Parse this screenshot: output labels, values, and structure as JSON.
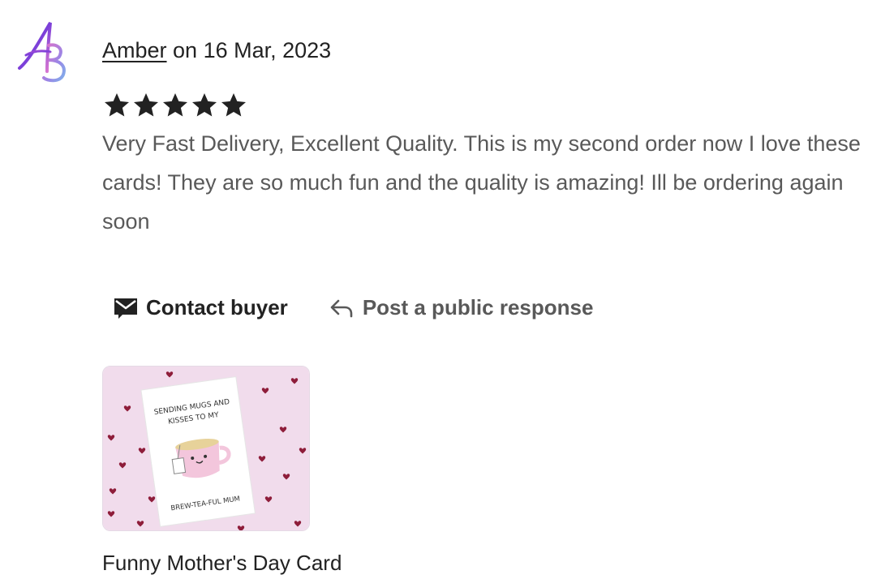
{
  "review": {
    "avatar_initials": "AB",
    "reviewer_name": "Amber",
    "date_text": " on 16 Mar, 2023",
    "rating": 5,
    "rating_max": 5,
    "text": "Very Fast Delivery, Excellent Quality. This is my second order now I love these cards! They are so much fun and the quality is amazing! Ill be ordering again soon"
  },
  "actions": {
    "contact_label": "Contact buyer",
    "contact_icon": "envelope-icon",
    "post_label": "Post a public response",
    "post_icon": "reply-arrow-icon"
  },
  "product": {
    "title": "Funny Mother's Day Card",
    "card_lines": [
      "SENDING MUGS AND",
      "KISSES TO MY",
      "BREW-TEA-FUL MUM"
    ]
  },
  "colors": {
    "text_primary": "#222222",
    "text_secondary": "#595959",
    "star": "#222222",
    "thumb_background": "#f1dcec",
    "heart": "#8e1d3a"
  }
}
